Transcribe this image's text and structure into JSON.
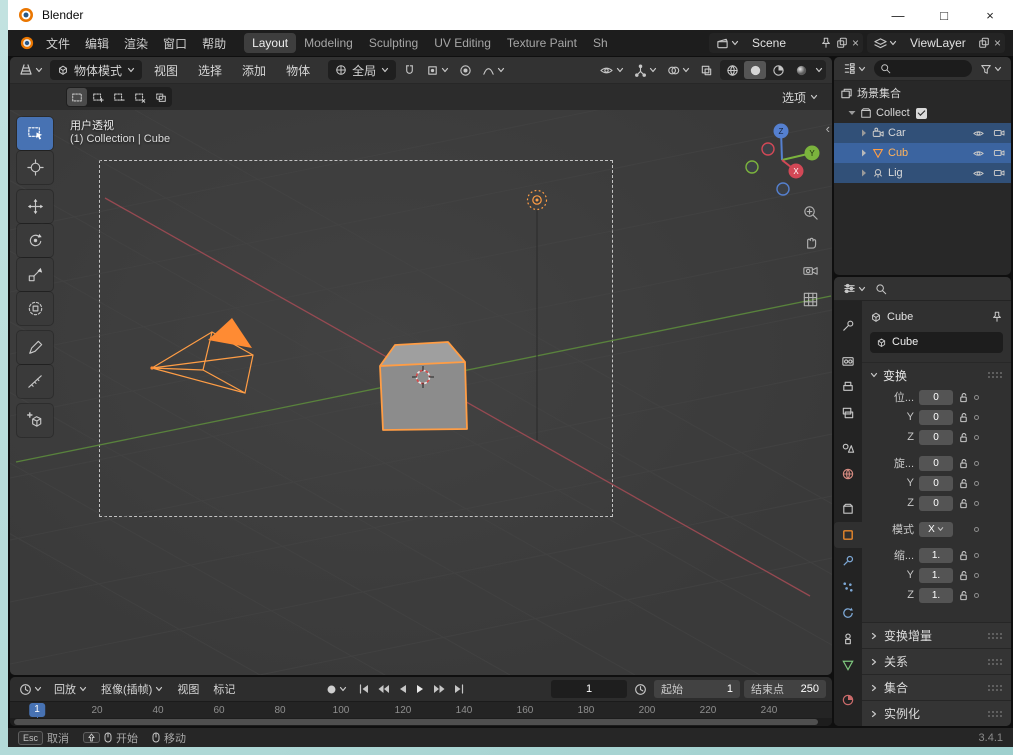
{
  "titlebar": {
    "title": "Blender",
    "minimize": "—",
    "maximize": "□",
    "close": "×"
  },
  "menubar": {
    "menus": [
      "文件",
      "编辑",
      "渲染",
      "窗口",
      "帮助"
    ],
    "workspaces": [
      "Layout",
      "Modeling",
      "Sculpting",
      "UV Editing",
      "Texture Paint",
      "Sh"
    ],
    "scene": {
      "value": "Scene"
    },
    "viewlayer": {
      "value": "ViewLayer"
    }
  },
  "toolheader": {
    "mode": "物体模式",
    "menus": [
      "视图",
      "选择",
      "添加",
      "物体"
    ],
    "orientation": "全局",
    "options": "选项"
  },
  "viewport": {
    "view_label": "用户透视",
    "context_label": "(1) Collection | Cube",
    "gizmo": {
      "x": "X",
      "y": "Y",
      "z": "Z"
    }
  },
  "outliner": {
    "scene_collection": "场景集合",
    "collection": "Collect",
    "objects": [
      "Car",
      "Cub",
      "Lig"
    ]
  },
  "properties": {
    "breadcrumb": "Cube",
    "object_name": "Cube",
    "transform_title": "变换",
    "rows": [
      {
        "label": "位...",
        "value": "0"
      },
      {
        "label": "Y",
        "value": "0"
      },
      {
        "label": "Z",
        "value": "0"
      },
      {
        "label": "旋...",
        "value": "0"
      },
      {
        "label": "Y",
        "value": "0"
      },
      {
        "label": "Z",
        "value": "0"
      }
    ],
    "mode_label": "模式",
    "mode_value": "X",
    "scale_rows": [
      {
        "label": "缩...",
        "value": "1."
      },
      {
        "label": "Y",
        "value": "1."
      },
      {
        "label": "Z",
        "value": "1."
      }
    ],
    "collapsed_sections": [
      "变换增量",
      "关系",
      "集合",
      "实例化"
    ]
  },
  "timeline": {
    "popovers": [
      "回放",
      "抠像(插帧)"
    ],
    "menus": [
      "视图",
      "标记"
    ],
    "current_frame": "1",
    "start_label": "起始",
    "start_value": "1",
    "end_label": "结束点",
    "end_value": "250",
    "marker": "1",
    "ticks": [
      "20",
      "40",
      "60",
      "80",
      "100",
      "120",
      "140",
      "160",
      "180",
      "200",
      "220",
      "240"
    ]
  },
  "statusbar": {
    "esc": "Esc",
    "cancel": "取消",
    "start": "开始",
    "move": "移动",
    "version": "3.4.1"
  }
}
